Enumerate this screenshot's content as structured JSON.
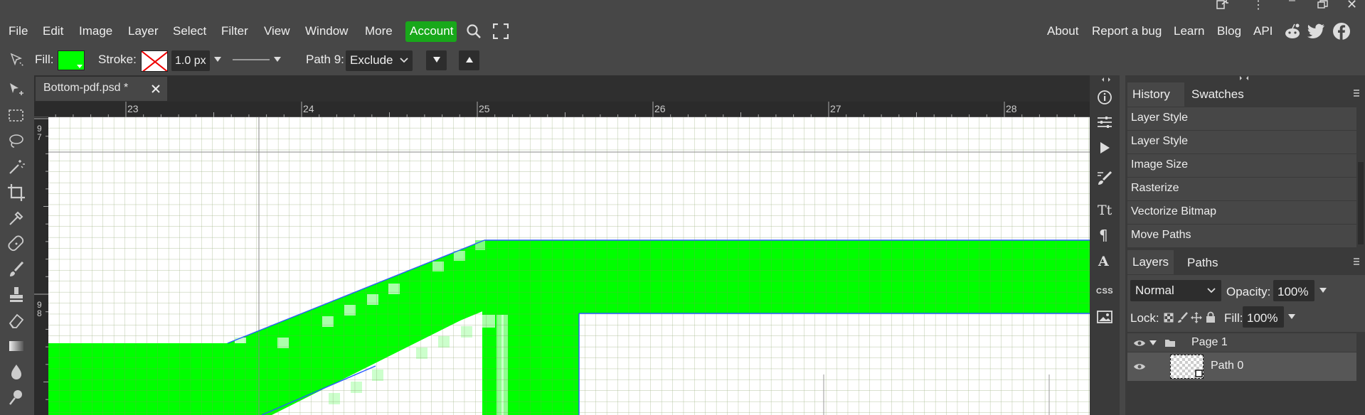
{
  "menu": {
    "items": [
      "File",
      "Edit",
      "Image",
      "Layer",
      "Select",
      "Filter",
      "View",
      "Window",
      "More"
    ],
    "account": "Account",
    "right_links": [
      "About",
      "Report a bug",
      "Learn",
      "Blog",
      "API"
    ]
  },
  "options": {
    "fill_label": "Fill:",
    "stroke_label": "Stroke:",
    "stroke_width": "1.0 px",
    "path_label": "Path 9:",
    "path_mode": "Exclude",
    "fill_color": "#00ff00"
  },
  "document": {
    "tab_title": "Bottom-pdf.psd *"
  },
  "ruler": {
    "top_labels": [
      "23",
      "24",
      "25",
      "26",
      "27",
      "28"
    ],
    "left_labels": [
      "9\n7",
      "9\n8"
    ]
  },
  "panels": {
    "history_tab": "History",
    "swatches_tab": "Swatches",
    "history_items": [
      "Layer Style",
      "Layer Style",
      "Image Size",
      "Rasterize",
      "Vectorize Bitmap",
      "Move Paths"
    ],
    "layers_tab": "Layers",
    "paths_tab": "Paths",
    "blend_mode": "Normal",
    "opacity_label": "Opacity:",
    "opacity_value": "100%",
    "lock_label": "Lock:",
    "fill_label": "Fill:",
    "fill_value": "100%",
    "layers": [
      {
        "name": "Page 1",
        "type": "folder"
      },
      {
        "name": "Path 0",
        "type": "path"
      }
    ]
  },
  "icon_col": {
    "css_label": "CSS"
  }
}
